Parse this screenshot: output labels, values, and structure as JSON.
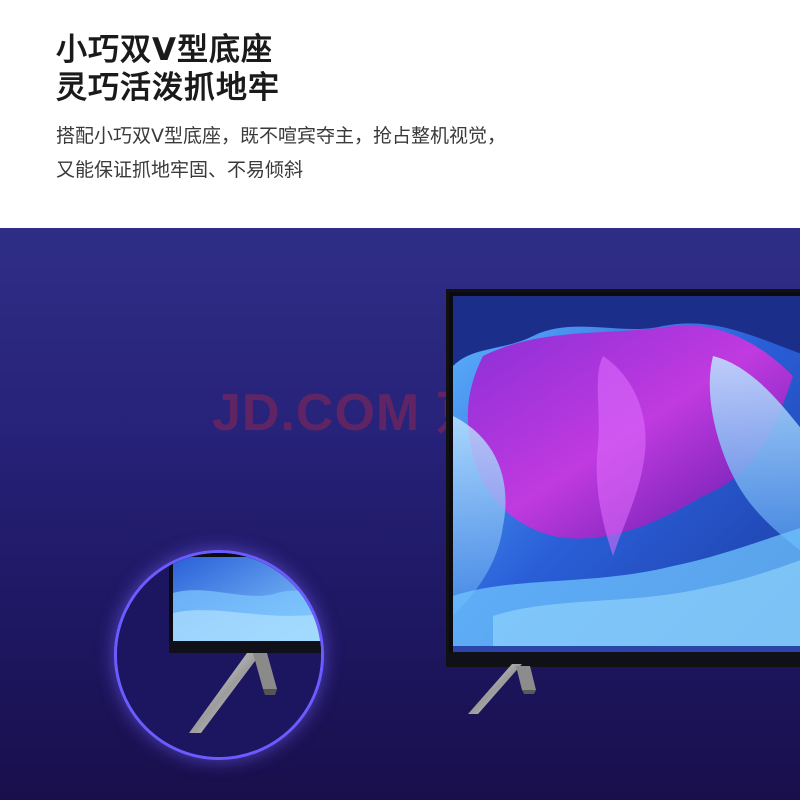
{
  "header": {
    "title_line_1": "小巧双V型底座",
    "title_line_2": "灵巧活泼抓地牢",
    "description_line_1": "搭配小巧双V型底座，既不喧宾夺主，抢占整机视觉，",
    "description_line_2": "又能保证抓地牢固、不易倾斜"
  },
  "watermark": {
    "text": "JD.COM 京东"
  },
  "colors": {
    "background_top": "#2f2e86",
    "background_bottom": "#190f4c",
    "zoom_ring": "#6b5cff",
    "watermark": "#c8283c"
  },
  "icons": {
    "tv": "television-with-v-stand",
    "stand": "v-shaped-stand-leg"
  }
}
